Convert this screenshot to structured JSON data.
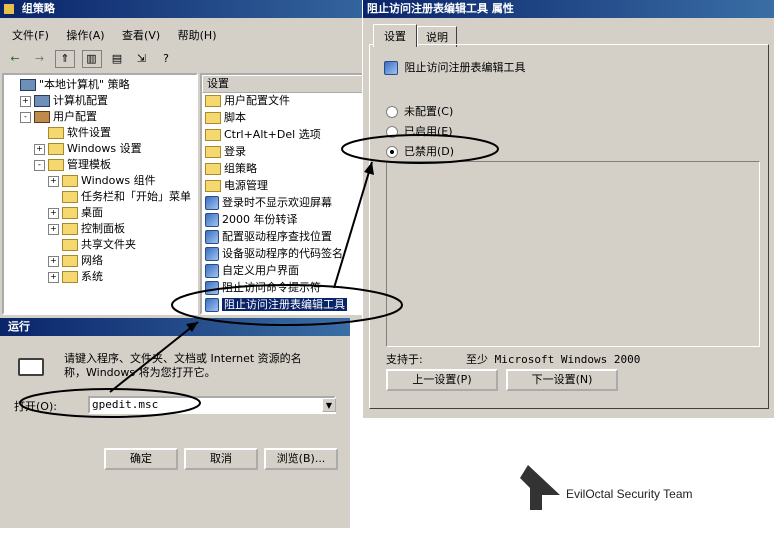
{
  "gpo": {
    "title": "组策略",
    "menu": [
      "文件(F)",
      "操作(A)",
      "查看(V)",
      "帮助(H)"
    ],
    "tree": [
      {
        "label": "\"本地计算机\" 策略",
        "indent": 0,
        "toggle": "",
        "icon": "computer"
      },
      {
        "label": "计算机配置",
        "indent": 1,
        "toggle": "+",
        "icon": "computer"
      },
      {
        "label": "用户配置",
        "indent": 1,
        "toggle": "-",
        "icon": "user"
      },
      {
        "label": "软件设置",
        "indent": 2,
        "toggle": "",
        "icon": "folder"
      },
      {
        "label": "Windows 设置",
        "indent": 2,
        "toggle": "+",
        "icon": "folder"
      },
      {
        "label": "管理模板",
        "indent": 2,
        "toggle": "-",
        "icon": "folder"
      },
      {
        "label": "Windows 组件",
        "indent": 3,
        "toggle": "+",
        "icon": "folder"
      },
      {
        "label": "任务栏和「开始」菜单",
        "indent": 3,
        "toggle": "",
        "icon": "folder"
      },
      {
        "label": "桌面",
        "indent": 3,
        "toggle": "+",
        "icon": "folder"
      },
      {
        "label": "控制面板",
        "indent": 3,
        "toggle": "+",
        "icon": "folder"
      },
      {
        "label": "共享文件夹",
        "indent": 3,
        "toggle": "",
        "icon": "folder"
      },
      {
        "label": "网络",
        "indent": 3,
        "toggle": "+",
        "icon": "folder"
      },
      {
        "label": "系统",
        "indent": 3,
        "toggle": "+",
        "icon": "folder-open"
      }
    ],
    "list_header": "设置",
    "list": [
      {
        "label": "用户配置文件",
        "icon": "folder"
      },
      {
        "label": "脚本",
        "icon": "folder"
      },
      {
        "label": "Ctrl+Alt+Del 选项",
        "icon": "folder"
      },
      {
        "label": "登录",
        "icon": "folder"
      },
      {
        "label": "组策略",
        "icon": "folder"
      },
      {
        "label": "电源管理",
        "icon": "folder"
      },
      {
        "label": "登录时不显示欢迎屏幕",
        "icon": "policy"
      },
      {
        "label": "2000 年份转译",
        "icon": "policy"
      },
      {
        "label": "配置驱动程序查找位置",
        "icon": "policy"
      },
      {
        "label": "设备驱动程序的代码签名",
        "icon": "policy"
      },
      {
        "label": "自定义用户界面",
        "icon": "policy"
      },
      {
        "label": "阻止访问命令提示符",
        "icon": "policy"
      },
      {
        "label": "阻止访问注册表编辑工具",
        "icon": "policy",
        "selected": true
      }
    ]
  },
  "run": {
    "title": "运行",
    "desc_line1": "请键入程序、文件夹、文档或 Internet 资源的名",
    "desc_line2": "称，Windows 将为您打开它。",
    "open_label": "打开(O):",
    "open_value": "gpedit.msc",
    "ok": "确定",
    "cancel": "取消",
    "browse": "浏览(B)..."
  },
  "props": {
    "title": "阻止访问注册表编辑工具 属性",
    "tabs": [
      "设置",
      "说明"
    ],
    "policy_name": "阻止访问注册表编辑工具",
    "options": [
      {
        "label": "未配置(C)",
        "checked": false
      },
      {
        "label": "已启用(E)",
        "checked": false
      },
      {
        "label": "已禁用(D)",
        "checked": true
      }
    ],
    "supported_label": "支持于:",
    "supported_value": "至少 Microsoft Windows 2000",
    "prev": "上一设置(P)",
    "next": "下一设置(N)"
  },
  "watermark": "EvilOctal Security Team"
}
